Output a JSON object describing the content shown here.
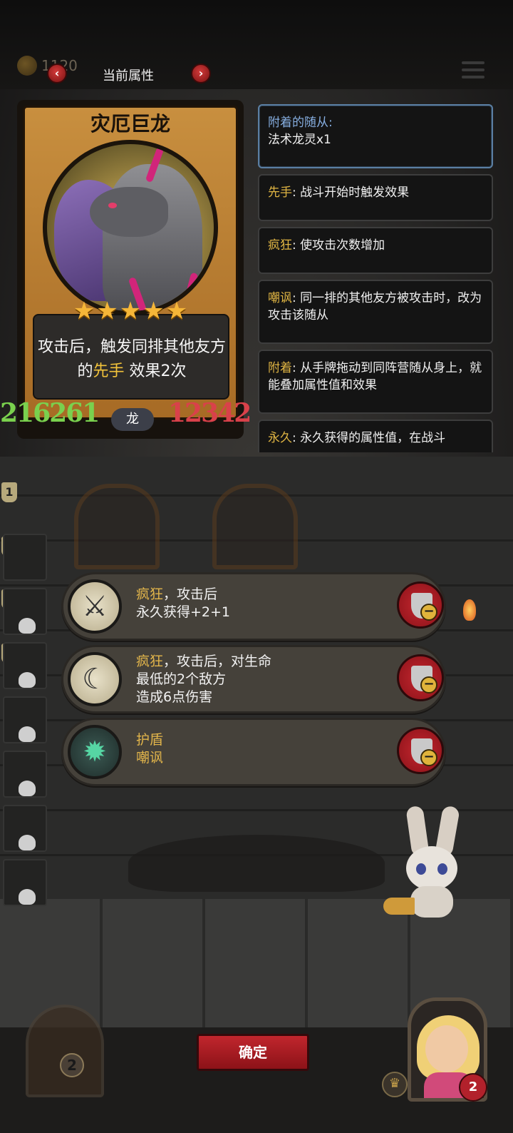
{
  "header": {
    "gold_value": "1120",
    "title": "当前属性",
    "prev_icon": "chevron-left-icon",
    "next_icon": "chevron-right-icon",
    "menu_icon": "menu-icon"
  },
  "card": {
    "name": "灾厄巨龙",
    "stars": 5,
    "desc_prefix": "攻击后，触发同排其他友方的",
    "desc_keyword": "先手",
    "desc_suffix": "效果2次",
    "attack": "216261",
    "type": "龙",
    "health": "12342"
  },
  "keywords": [
    {
      "title": "附着的随从:",
      "text": "法术龙灵x1"
    },
    {
      "title": "先手",
      "text": ": 战斗开始时触发效果"
    },
    {
      "title": "疯狂",
      "text": ": 使攻击次数增加"
    },
    {
      "title": "嘲讽",
      "text": ": 同一排的其他友方被攻击时，改为攻击该随从"
    },
    {
      "title": "附着",
      "text": ": 从手牌拖动到同阵营随从身上，就能叠加属性值和效果"
    },
    {
      "title": "永久",
      "text": ": 永久获得的属性值，在战斗"
    }
  ],
  "rows": [
    "1",
    "2",
    "3",
    "4"
  ],
  "effects": [
    {
      "keyword": "疯狂",
      "line1_rest": "，攻击后",
      "line2": "永久获得+2+1",
      "line3": "",
      "icon": "crossed-swords-icon"
    },
    {
      "keyword": "疯狂",
      "line1_rest": "，攻击后，对生命",
      "line2": "最低的2个敌方",
      "line3": "造成6点伤害",
      "icon": "scythe-icon"
    },
    {
      "keyword": "护盾",
      "line1_rest": "",
      "line2": "嘲讽",
      "line3": "",
      "icon": "shield-creature-icon"
    }
  ],
  "footer": {
    "confirm_label": "确定",
    "gate_count": "2",
    "hero_hearts": "2"
  },
  "colors": {
    "keyword_yellow": "#e2b54b",
    "attack_green": "#7ad14e",
    "health_red": "#d9414a",
    "button_red": "#c1262d"
  }
}
